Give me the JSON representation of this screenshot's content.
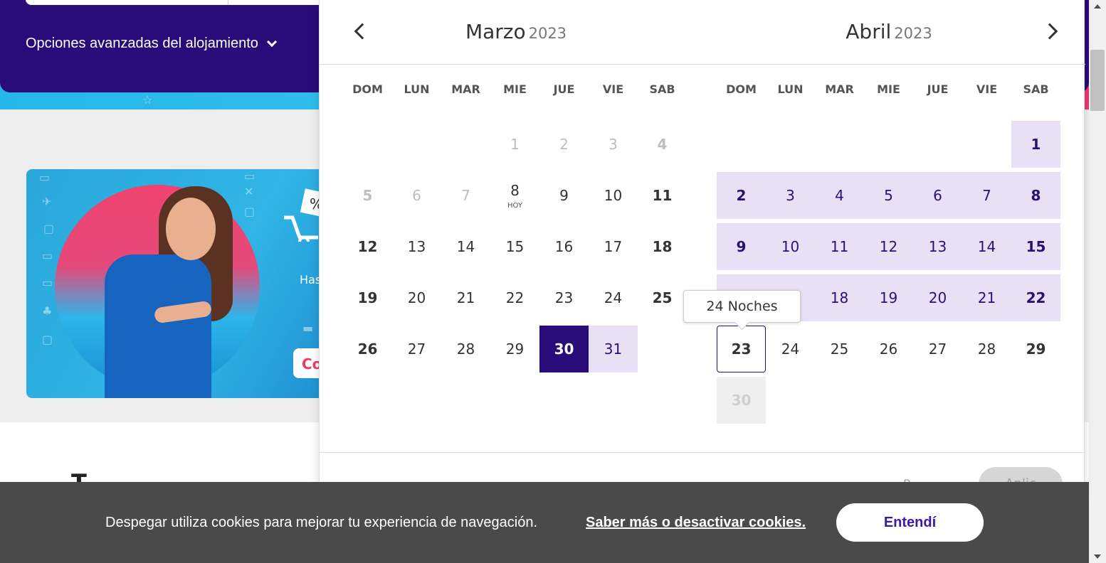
{
  "search": {
    "advanced_options_label": "Opciones avanzadas del alojamiento",
    "advanced_options_icon": "chevron-down-icon"
  },
  "promo": {
    "partial_text": "Has",
    "cta_partial": "Co"
  },
  "page": {
    "heading_partial": "T"
  },
  "datepicker": {
    "prev_icon": "chevron-left-icon",
    "next_icon": "chevron-right-icon",
    "weekdays": [
      "DOM",
      "LUN",
      "MAR",
      "MIE",
      "JUE",
      "VIE",
      "SAB"
    ],
    "left_month": {
      "name": "Marzo",
      "year": "2023"
    },
    "right_month": {
      "name": "Abril",
      "year": "2023"
    },
    "today_label": "HOY",
    "tooltip": "24 Noches",
    "apply_partial": "Aplic",
    "clear_partial": "B",
    "colors": {
      "selected": "#2a0b7a",
      "range": "#e8e1f5",
      "disabled": "#bdbdbd"
    }
  },
  "cookies": {
    "message": "Despegar utiliza cookies para mejorar tu experiencia de navegación.",
    "link": "Saber más o desactivar cookies.",
    "accept_button": "Entendí"
  }
}
